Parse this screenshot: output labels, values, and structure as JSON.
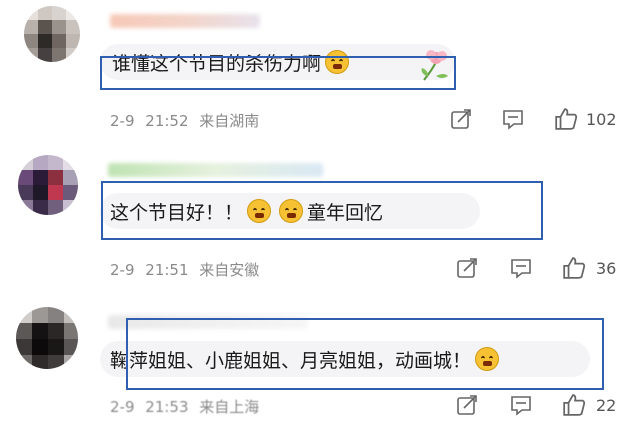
{
  "comments": [
    {
      "text": "谁懂这个节目的杀伤力啊",
      "emojis": [
        "crying-face"
      ],
      "date": "2-9",
      "time": "21:52",
      "location": "来自湖南",
      "likes": "102"
    },
    {
      "text_before": "这个节目好！！",
      "emojis": [
        "crying-face",
        "crying-face"
      ],
      "text_after": "童年回忆",
      "date": "2-9",
      "time": "21:51",
      "location": "来自安徽",
      "likes": "36"
    },
    {
      "text": "鞠萍姐姐、小鹿姐姐、月亮姐姐，动画城！",
      "emojis": [
        "crying-face"
      ],
      "date": "2-9",
      "time": "21:53",
      "location": "来自上海",
      "likes": "22"
    }
  ],
  "icons": [
    "share-icon",
    "comment-icon",
    "like-icon"
  ],
  "colors": {
    "highlight_box": "#2f5fb0",
    "meta_text": "#8a8a8a",
    "bubble": "#f4f4f6"
  }
}
